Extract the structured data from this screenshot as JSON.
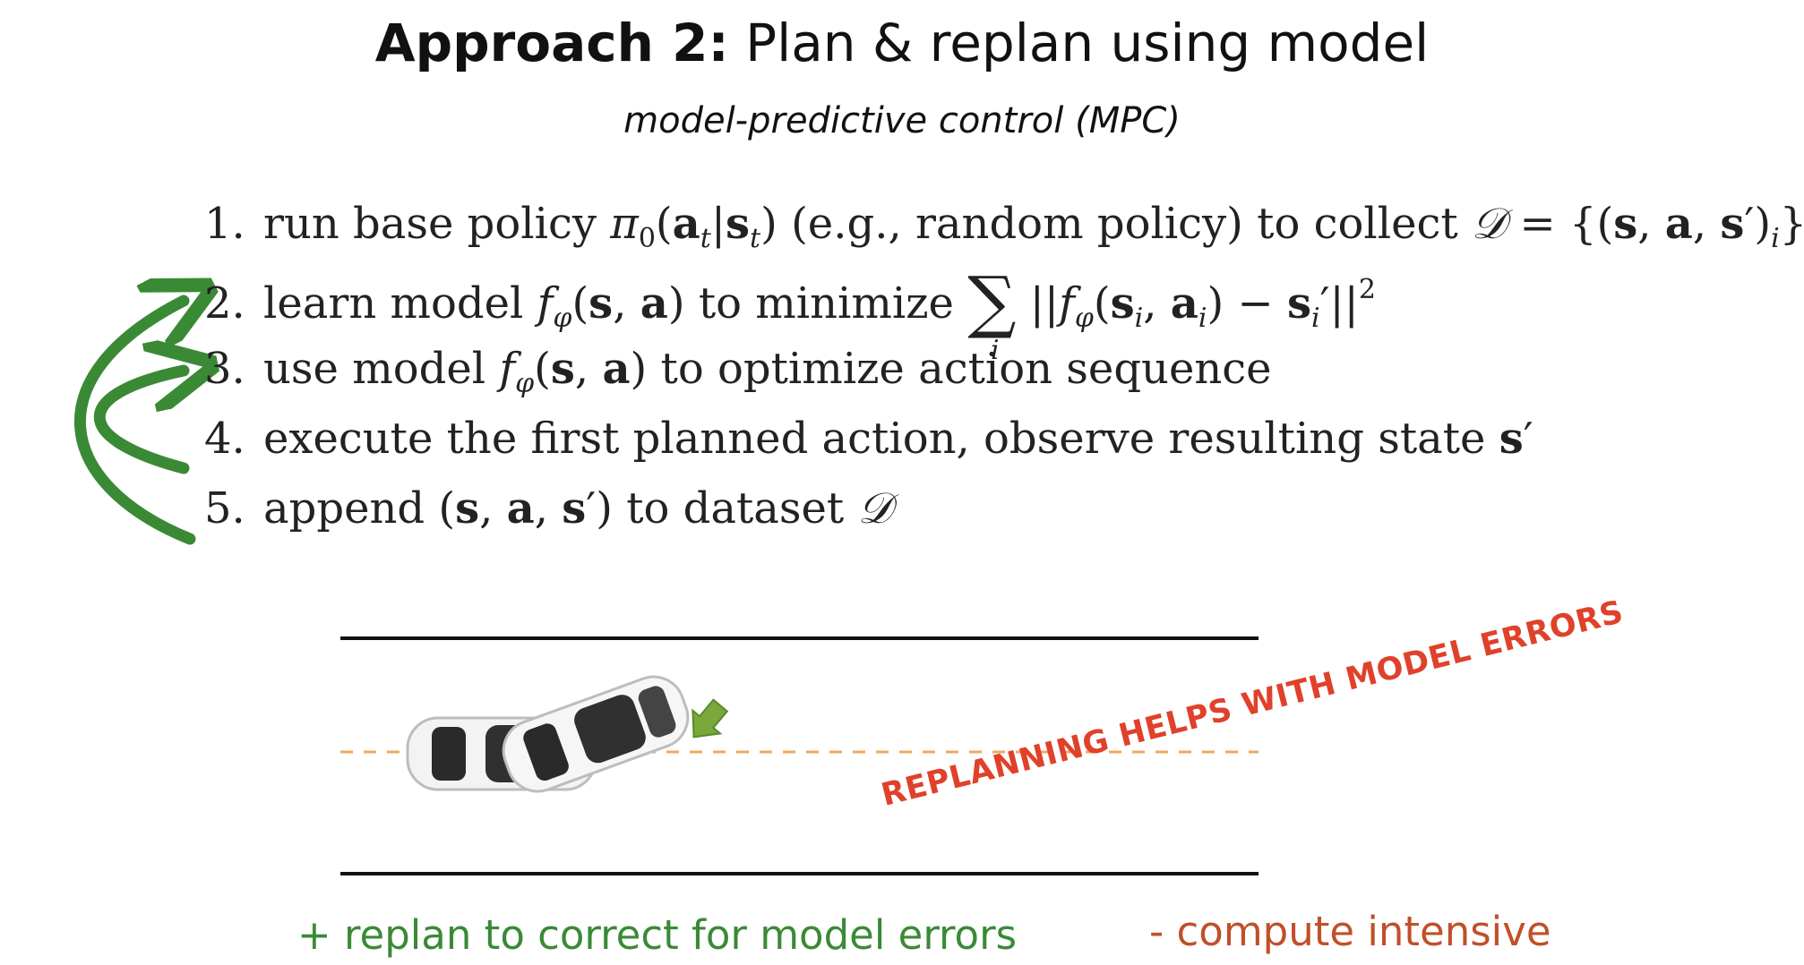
{
  "header": {
    "title_bold": "Approach 2:",
    "title_rest": " Plan & replan using model",
    "subtitle": "model-predictive control (MPC)"
  },
  "steps": [
    {
      "number": "1.",
      "text": "run base policy π₀(aₜ|sₜ) (e.g., random policy) to collect 𝒟 = {(s, a, s′)ᵢ}"
    },
    {
      "number": "2.",
      "text": "learn model f_φ(s, a) to minimize Σᵢ ||f_φ(sᵢ, aᵢ) − s′ᵢ||²"
    },
    {
      "number": "3.",
      "text": "use model f_φ(s, a) to optimize action sequence"
    },
    {
      "number": "4.",
      "text": "execute the first planned action, observe resulting state s′"
    },
    {
      "number": "5.",
      "text": "append (s, a, s′) to dataset 𝒟"
    }
  ],
  "math": {
    "s1_a": "run base policy ",
    "s1_pi": "π",
    "s1_zero": "0",
    "s1_b": " (e.g., random policy) to collect ",
    "s1_D": "𝒟",
    "s1_c": " = {(",
    "s2_a": "learn model ",
    "s2_b": " to minimize ",
    "s2_sum": "∑",
    "s2_i": "i",
    "s3_a": "use model ",
    "s3_b": " to optimize action sequence",
    "s4_a": "execute the first planned action, observe resulting state ",
    "s5_a": "append ",
    "s5_b": " to dataset ",
    "s5_D": "𝒟"
  },
  "colors": {
    "arrow_green": "#3a8a35",
    "banner_red": "#e0412a",
    "con_red": "#c0502a",
    "dashed_orange": "#f0a860",
    "turn_arrow": "#7aa83a"
  },
  "illustration": {
    "banner": "REPLANNING HELPS WITH MODEL ERRORS"
  },
  "footer": {
    "pro": "+ replan to correct for model errors",
    "con": "- compute intensive"
  }
}
